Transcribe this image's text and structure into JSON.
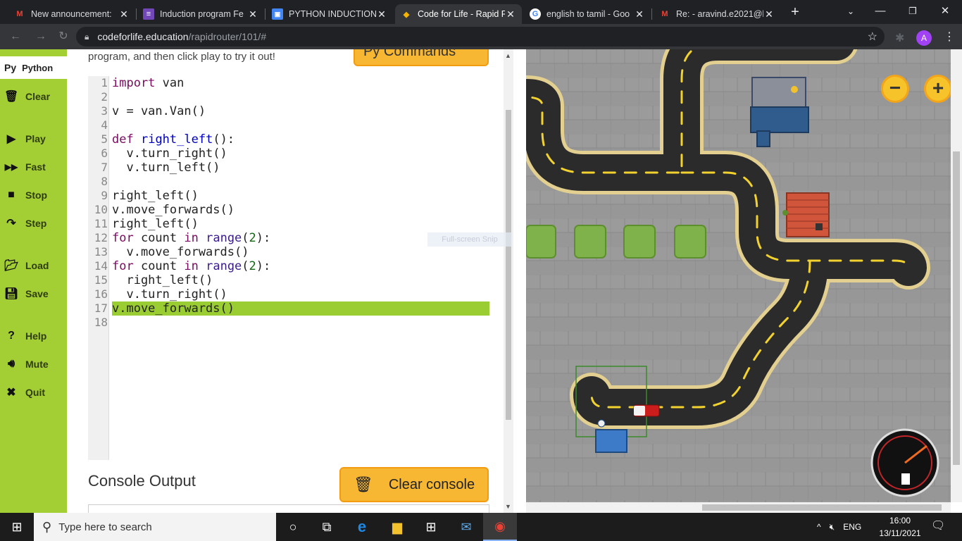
{
  "browser": {
    "tabs": [
      {
        "title": "New announcement: ",
        "favicon": "gmail-icon"
      },
      {
        "title": "Induction program Fe",
        "favicon": "forms-icon"
      },
      {
        "title": "PYTHON INDUCTION",
        "favicon": "classroom-icon"
      },
      {
        "title": "Code for Life - Rapid R",
        "favicon": "codeforlife-icon",
        "active": true
      },
      {
        "title": "english to tamil - Goo",
        "favicon": "google-icon"
      },
      {
        "title": "Re: - aravind.e2021@k",
        "favicon": "gmail-icon"
      }
    ],
    "url_host": "codeforlife.education",
    "url_path": "/rapidrouter/101/#",
    "profile_initial": "A"
  },
  "sidebar": {
    "python_label": "Python",
    "python_prefix": "Py",
    "items": [
      {
        "label": "Clear",
        "icon": "trash-icon"
      },
      {
        "label": "Play",
        "icon": "play-icon"
      },
      {
        "label": "Fast",
        "icon": "fast-forward-icon"
      },
      {
        "label": "Stop",
        "icon": "stop-icon"
      },
      {
        "label": "Step",
        "icon": "step-icon"
      },
      {
        "label": "Load",
        "icon": "folder-icon"
      },
      {
        "label": "Save",
        "icon": "save-icon"
      },
      {
        "label": "Help",
        "icon": "help-icon"
      },
      {
        "label": "Mute",
        "icon": "speaker-icon"
      },
      {
        "label": "Quit",
        "icon": "close-icon"
      }
    ]
  },
  "editor": {
    "intro_text": "program, and then click play to try it out!",
    "commands_label": "Py   Commands",
    "lines": [
      "import van",
      "",
      "v = van.Van()",
      "",
      "def right_left():",
      "  v.turn_right()",
      "  v.turn_left()",
      "",
      "right_left()",
      "v.move_forwards()",
      "right_left()",
      "for count in range(2):",
      "  v.move_forwards()",
      "for count in range(2):",
      "  right_left()",
      "  v.turn_right()",
      "v.move_forwards()",
      ""
    ],
    "highlighted_line": 17
  },
  "console": {
    "title": "Console Output",
    "clear_label": "Clear console"
  },
  "game": {
    "zoom_out": "−",
    "zoom_in": "+",
    "snip_label": "Full-screen Snip"
  },
  "taskbar": {
    "search_placeholder": "Type here to search",
    "lang": "ENG",
    "time": "16:00",
    "date": "13/11/2021"
  },
  "colors": {
    "sidebar": "#a3cf34",
    "button": "#f7b733",
    "highlight": "#9acd32",
    "road": "#2b2b2b",
    "road_edge": "#e8d59a",
    "pavement": "#979797"
  }
}
